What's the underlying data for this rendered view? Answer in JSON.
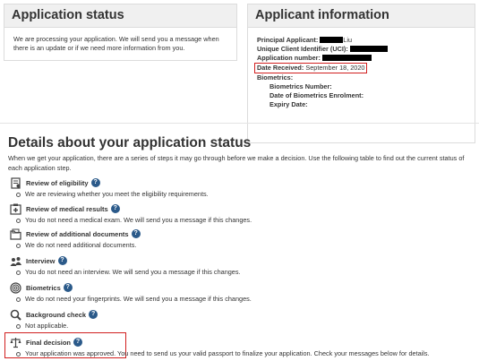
{
  "status_panel": {
    "title": "Application status",
    "body": "We are processing your application. We will send you a message when there is an update or if we need more information from you."
  },
  "info_panel": {
    "title": "Applicant information",
    "principal_label": "Principal Applicant:",
    "principal_visible": "Liu",
    "uci_label": "Unique Client Identifier (UCI):",
    "app_number_label": "Application number:",
    "date_label": "Date Received:",
    "date_value": "September 18, 2020",
    "biometrics_label": "Biometrics:",
    "biometrics_number_label": "Biometrics Number:",
    "biometrics_date_label": "Date of Biometrics Enrolment:",
    "expiry_label": "Expiry Date:"
  },
  "details": {
    "title": "Details about your application status",
    "intro": "When we get your application, there are a series of steps it may go through before we make a decision. Use the following table to find out the current status of each application step.",
    "steps": [
      {
        "title": "Review of eligibility",
        "desc": "We are reviewing whether you meet the eligibility requirements.",
        "icon": "eligibility-icon"
      },
      {
        "title": "Review of medical results",
        "desc": "You do not need a medical exam. We will send you a message if this changes.",
        "icon": "medical-icon"
      },
      {
        "title": "Review of additional documents",
        "desc": "We do not need additional documents.",
        "icon": "documents-icon"
      },
      {
        "title": "Interview",
        "desc": "You do not need an interview. We will send you a message if this changes.",
        "icon": "interview-icon"
      },
      {
        "title": "Biometrics",
        "desc": "We do not need your fingerprints. We will send you a message if this changes.",
        "icon": "fingerprint-icon"
      },
      {
        "title": "Background check",
        "desc": "Not applicable.",
        "icon": "search-icon"
      },
      {
        "title": "Final decision",
        "desc": "Your application was approved. You need to send us your valid passport to finalize your application. Check your messages below for details.",
        "icon": "scales-icon"
      }
    ]
  },
  "colors": {
    "highlight": "#d11f1f",
    "help_icon": "#2b5a8a",
    "panel_header": "#f0f0f0"
  }
}
